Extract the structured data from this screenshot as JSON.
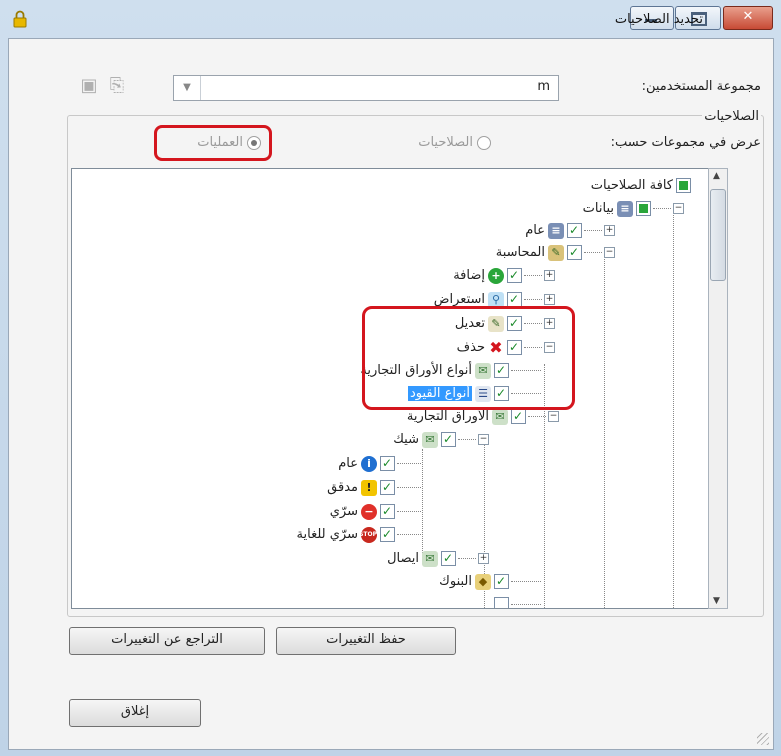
{
  "window": {
    "title": "تحديد الصلاحيات",
    "close_glyph": "✕"
  },
  "form": {
    "user_group_label": "مجموعة المستخدمين:",
    "user_group_value": "m",
    "permissions_section_label": "الصلاحيات",
    "view_by_label": "عرض في مجموعات حسب:",
    "radio_permissions": "الصلاحيات",
    "radio_operations": "العمليات"
  },
  "tree": {
    "root": "كافة الصلاحيات",
    "data": "بيانات",
    "general": "عام",
    "accounting": "المحاسبة",
    "add": "إضافة",
    "view": "استعراض",
    "edit": "تعديل",
    "delete": "حذف",
    "commercial_paper_types": "أنواع الأوراق التجارية",
    "entry_types": "أنواع القيود",
    "commercial_papers": "الأوراق التجارية",
    "check": "شيك",
    "check_general": "عام",
    "check_audited": "مدقق",
    "check_secret": "سرّي",
    "check_top_secret": "سرّي للغاية",
    "receipt": "ايصال",
    "banks": "البنوك"
  },
  "buttons": {
    "save_changes": "حفظ التغييرات",
    "revert_changes": "التراجع عن التغييرات",
    "close": "إغلاق"
  },
  "colors": {
    "highlight_red": "#d4161e",
    "selection_blue": "#3399ff",
    "check_green": "#1a8a2a"
  }
}
